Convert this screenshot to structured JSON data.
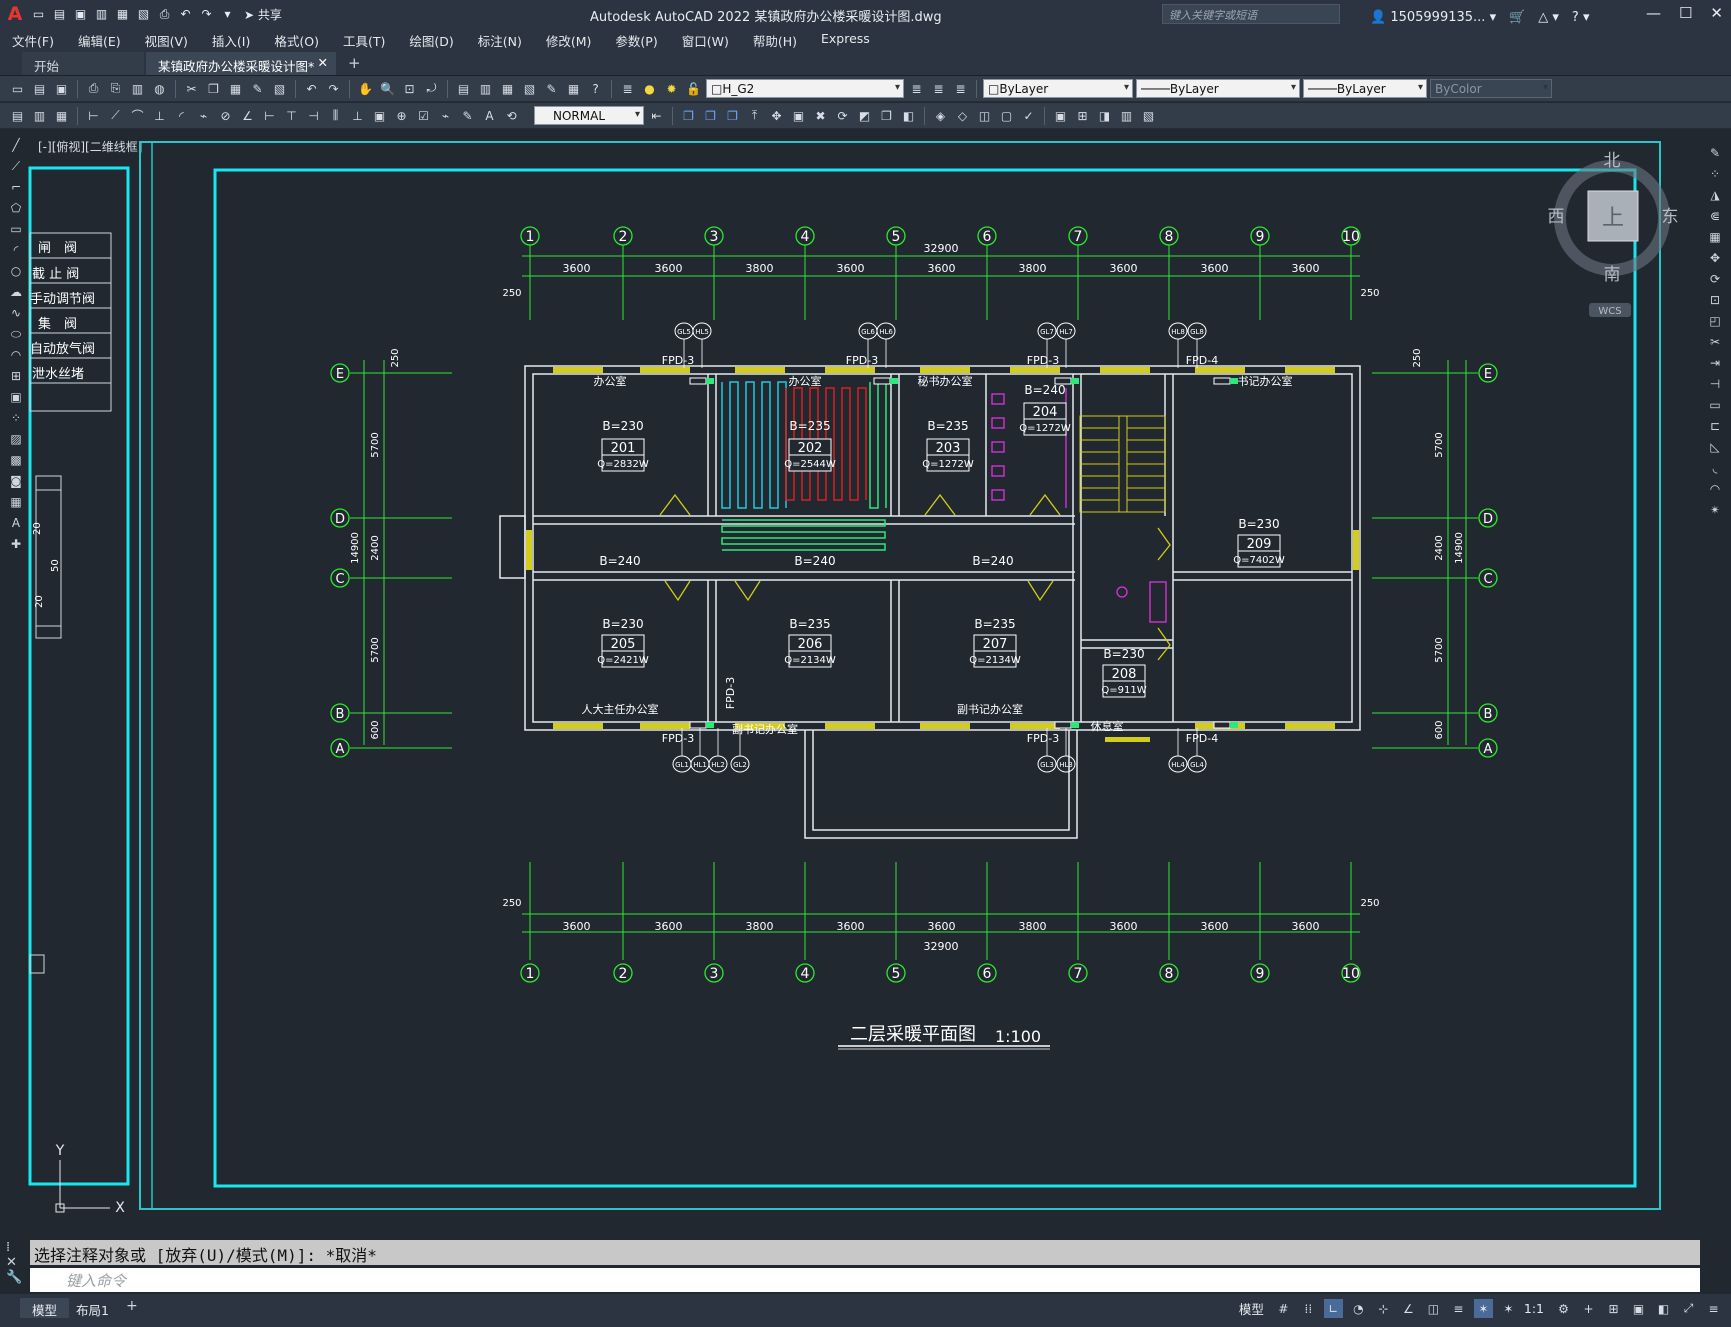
{
  "app": {
    "title": "Autodesk AutoCAD 2022   某镇政府办公楼采暖设计图.dwg",
    "share_label": "共享",
    "search_placeholder": "键入关键字或短语",
    "user": "1505999135...",
    "window_controls": [
      "—",
      "☐",
      "✕"
    ]
  },
  "menu": [
    "文件(F)",
    "编辑(E)",
    "视图(V)",
    "插入(I)",
    "格式(O)",
    "工具(T)",
    "绘图(D)",
    "标注(N)",
    "修改(M)",
    "参数(P)",
    "窗口(W)",
    "帮助(H)",
    "Express"
  ],
  "tabs": {
    "start": "开始",
    "doc": "某镇政府办公楼采暖设计图*",
    "doc_close": "✕",
    "new_tab": "+"
  },
  "toolbar": {
    "layer": "H_G2",
    "color": "ByLayer",
    "linetype": "ByLayer",
    "lineweight": "ByLayer",
    "plotstyle": "ByColor",
    "dimstyle": "NORMAL"
  },
  "viewport": {
    "label": "[-][俯视][二维线框]",
    "viewcube": {
      "north": "北",
      "south": "南",
      "west": "西",
      "east": "东",
      "top": "上",
      "wcs": "WCS"
    },
    "ucs": {
      "y": "Y",
      "x": "X"
    }
  },
  "legend": {
    "items": [
      "闸　阀",
      "截 止 阀",
      "手动调节阀",
      "集　阀",
      "自动放气阀",
      "泄水丝堵"
    ],
    "dims": [
      "20",
      "50",
      "20"
    ]
  },
  "drawing": {
    "title": "二层采暖平面图",
    "scale": "1:100",
    "axes_numbers": [
      "1",
      "2",
      "3",
      "4",
      "5",
      "6",
      "7",
      "8",
      "9",
      "10"
    ],
    "axes_letters": [
      "E",
      "D",
      "C",
      "B",
      "A"
    ],
    "span_dims": [
      "3600",
      "3600",
      "3800",
      "3600",
      "3600",
      "3800",
      "3600",
      "3600",
      "3600"
    ],
    "total_width": "32900",
    "edge_dim": "250",
    "depth_dims": [
      "5700",
      "2400",
      "5700",
      "600"
    ],
    "total_depth": "14900",
    "manifold_labels": [
      "FPD-3",
      "FPD-3",
      "FPD-3",
      "FPD-4",
      "FPD-3",
      "FPD-3",
      "FPD-4",
      "FPD-3"
    ],
    "corridor_walls": [
      "B=240",
      "B=240",
      "B=240"
    ],
    "rooms": [
      {
        "name": "办公室",
        "wall": "B=230",
        "no": "201",
        "q": "Q=2832W"
      },
      {
        "name": "办公室",
        "wall": "B=235",
        "no": "202",
        "q": "Q=2544W"
      },
      {
        "name": "秘书办公室",
        "wall": "B=235",
        "no": "203",
        "q": "Q=1272W"
      },
      {
        "name": "",
        "wall": "B=240",
        "no": "204",
        "q": "Q=1272W"
      },
      {
        "name": "人大主任办公室",
        "wall": "B=230",
        "no": "205",
        "q": "Q=2421W"
      },
      {
        "name": "副书记办公室",
        "wall": "B=235",
        "no": "206",
        "q": "Q=2134W"
      },
      {
        "name": "副书记办公室",
        "wall": "B=235",
        "no": "207",
        "q": "Q=2134W"
      },
      {
        "name": "休息室",
        "wall": "B=230",
        "no": "208",
        "q": "Q=911W"
      },
      {
        "name": "书记办公室",
        "wall": "B=230",
        "no": "209",
        "q": "Q=7402W"
      }
    ],
    "riser_tags": [
      "GL5",
      "HL5",
      "GL6",
      "HL6",
      "GL7",
      "HL7",
      "HL8",
      "GL8",
      "GL1",
      "HL1",
      "HL2",
      "GL2",
      "GL3",
      "HL3",
      "HL4",
      "GL4"
    ]
  },
  "command": {
    "history": "选择注释对象或 [放弃(U)/模式(M)]: *取消*",
    "placeholder": "键入命令"
  },
  "status": {
    "model_tab": "模型",
    "layout_tab": "布局1",
    "add": "+",
    "model_label": "模型",
    "scale": "1:1"
  }
}
